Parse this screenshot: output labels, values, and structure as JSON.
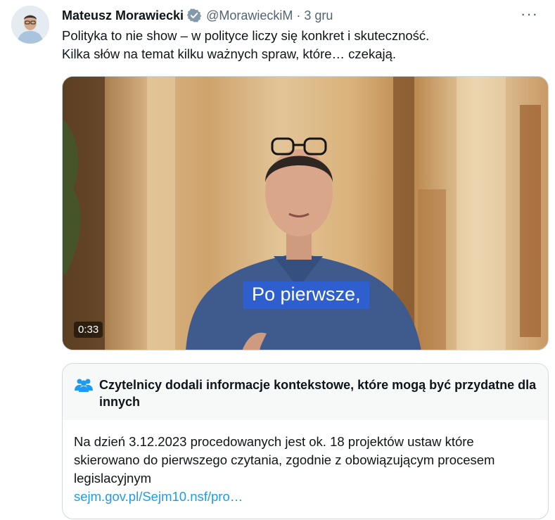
{
  "tweet": {
    "author_name": "Mateusz Morawiecki",
    "handle": "@MorawieckiM",
    "separator": "·",
    "time": "3 gru",
    "more_label": "···",
    "text_line1": "Polityka to nie show – w polityce liczy się konkret i skuteczność.",
    "text_line2": "Kilka słów na temat kilku ważnych spraw, które… czekają.",
    "icons": {
      "verified": "verified-badge-icon",
      "more": "more-options-icon"
    },
    "colors": {
      "verified": "#829aab",
      "link": "#1d9bf0",
      "caption_bg": "#2f5fce"
    }
  },
  "media": {
    "caption": "Po pierwsze,",
    "duration": "0:33"
  },
  "community_note": {
    "title": "Czytelnicy dodali informacje kontekstowe, które mogą być przydatne dla innych",
    "body": "Na dzień 3.12.2023 procedowanych jest ok. 18 projektów ustaw które skierowano do pierwszego czytania, zgodnie z obowiązującym procesem legislacyjnym",
    "link": "sejm.gov.pl/Sejm10.nsf/pro…",
    "icon": "people-icon"
  }
}
